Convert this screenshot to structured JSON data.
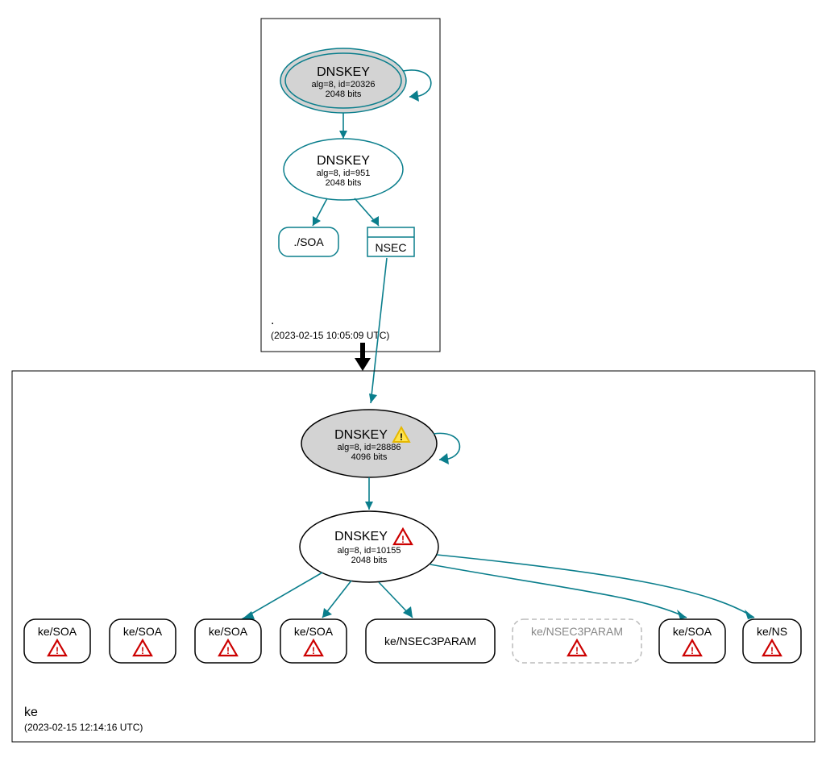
{
  "zones": {
    "root": {
      "name": ".",
      "timestamp": "(2023-02-15 10:05:09 UTC)"
    },
    "child": {
      "name": "ke",
      "timestamp": "(2023-02-15 12:14:16 UTC)"
    }
  },
  "nodes": {
    "root_ksk": {
      "title": "DNSKEY",
      "line1": "alg=8, id=20326",
      "line2": "2048 bits"
    },
    "root_zsk": {
      "title": "DNSKEY",
      "line1": "alg=8, id=951",
      "line2": "2048 bits"
    },
    "root_soa": {
      "label": "./SOA"
    },
    "root_nsec": {
      "label": "NSEC"
    },
    "ke_ksk": {
      "title": "DNSKEY",
      "line1": "alg=8, id=28886",
      "line2": "4096 bits"
    },
    "ke_zsk": {
      "title": "DNSKEY",
      "line1": "alg=8, id=10155",
      "line2": "2048 bits"
    },
    "leaf1": {
      "label": "ke/SOA"
    },
    "leaf2": {
      "label": "ke/SOA"
    },
    "leaf3": {
      "label": "ke/SOA"
    },
    "leaf4": {
      "label": "ke/SOA"
    },
    "leaf5": {
      "label": "ke/NSEC3PARAM"
    },
    "leaf6": {
      "label": "ke/NSEC3PARAM"
    },
    "leaf7": {
      "label": "ke/SOA"
    },
    "leaf8": {
      "label": "ke/NS"
    }
  },
  "colors": {
    "edge": "#0a7e8c",
    "warn": "#e6b800",
    "error": "#cc0000"
  }
}
